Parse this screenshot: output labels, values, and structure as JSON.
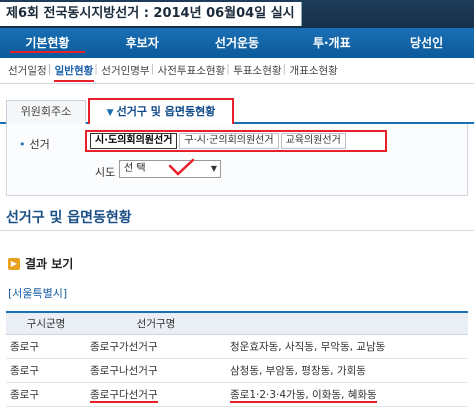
{
  "header": {
    "title": "제6회 전국동시지방선거 : 2014년 06월04일 실시"
  },
  "main_nav": [
    "기본현황",
    "후보자",
    "선거운동",
    "투·개표",
    "당선인"
  ],
  "sub_nav": [
    "선거일정",
    "일반현황",
    "선거인명부",
    "사전투표소현황",
    "투표소현황",
    "개표소현황"
  ],
  "tabs": [
    "위원회주소",
    "선거구 및 읍면동현황"
  ],
  "filter": {
    "election_label": "선거",
    "elections": [
      "시·도의회의원선거",
      "구·시·군의회의원선거",
      "교육의원선거"
    ],
    "sido_label": "시도",
    "sido_value": "선 택"
  },
  "section_title": "선거구 및 읍면동현황",
  "result_heading": "결과 보기",
  "region": "[서울특별시]",
  "table": {
    "headers": [
      "구시군명",
      "선거구명",
      ""
    ],
    "rows": [
      [
        "종로구",
        "종로구가선거구",
        "청운효자동, 사직동, 무악동, 교남동"
      ],
      [
        "종로구",
        "종로구나선거구",
        "삼청동, 부암동, 평창동, 가회동"
      ],
      [
        "종로구",
        "종로구다선거구",
        "종로1·2·3·4가동, 이화동, 혜화동"
      ]
    ]
  },
  "colors": {
    "accent_red": "#e8202a",
    "nav_blue": "#1a6fb5",
    "title_dark": "#15304a"
  }
}
